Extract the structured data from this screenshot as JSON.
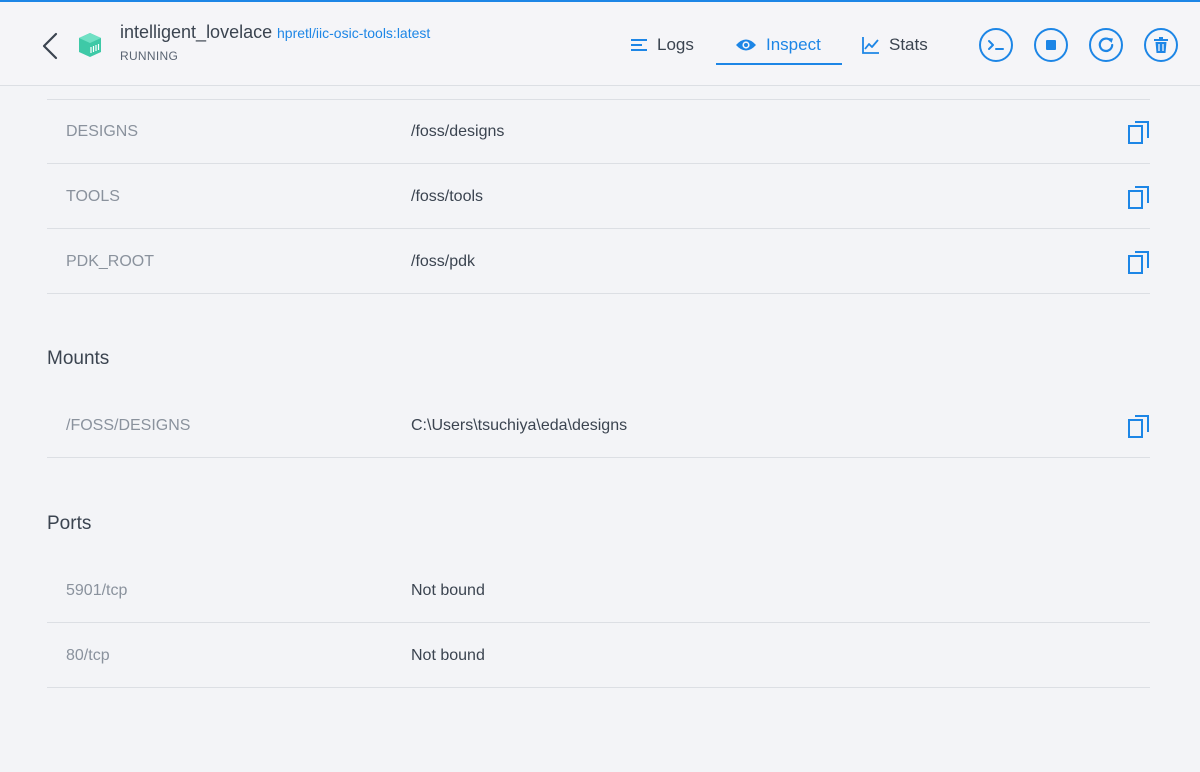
{
  "container": {
    "name": "intelligent_lovelace",
    "image": "hpretl/iic-osic-tools:latest",
    "status": "RUNNING"
  },
  "tabs": [
    {
      "label": "Logs",
      "icon": "list-icon"
    },
    {
      "label": "Inspect",
      "icon": "eye-icon",
      "active": true
    },
    {
      "label": "Stats",
      "icon": "chart-icon"
    }
  ],
  "actions": [
    "terminal-icon",
    "stop-icon",
    "restart-icon",
    "delete-icon"
  ],
  "env": [
    {
      "key": "DESIGNS",
      "value": "/foss/designs"
    },
    {
      "key": "TOOLS",
      "value": "/foss/tools"
    },
    {
      "key": "PDK_ROOT",
      "value": "/foss/pdk"
    }
  ],
  "mounts": {
    "title": "Mounts",
    "items": [
      {
        "key": "/FOSS/DESIGNS",
        "value": "C:\\Users\\tsuchiya\\eda\\designs"
      }
    ]
  },
  "ports": {
    "title": "Ports",
    "items": [
      {
        "key": "5901/tcp",
        "value": "Not bound"
      },
      {
        "key": "80/tcp",
        "value": "Not bound"
      }
    ]
  },
  "colors": {
    "accent": "#1d86e6",
    "container_icon": "#3ec9a7"
  }
}
